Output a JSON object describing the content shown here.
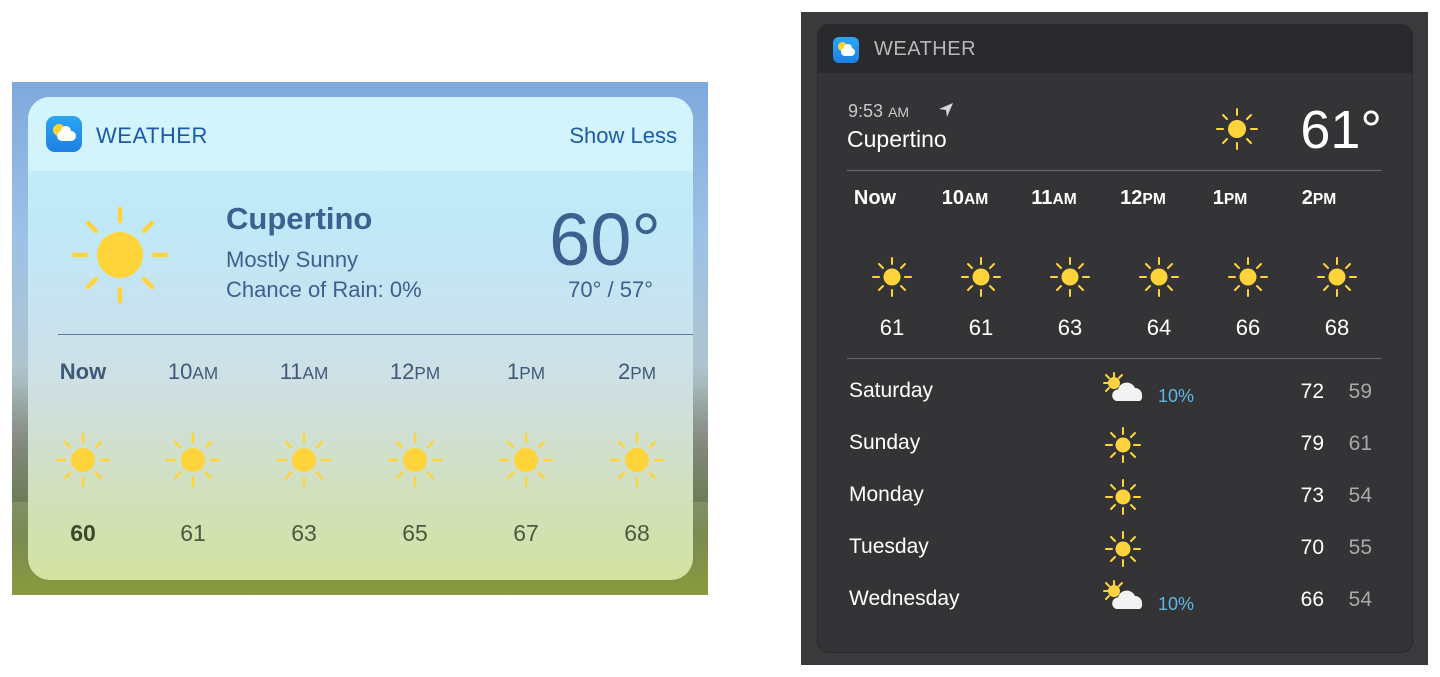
{
  "ios_widget": {
    "app_name": "WEATHER",
    "show_less_label": "Show Less",
    "city": "Cupertino",
    "condition": "Mostly Sunny",
    "chance_of_rain": "Chance of Rain: 0%",
    "temperature": "60°",
    "high_low": "70° / 57°",
    "hourly": [
      {
        "hour": "Now",
        "suffix": "",
        "icon": "sun-icon",
        "temp": "60"
      },
      {
        "hour": "10",
        "suffix": "AM",
        "icon": "sun-icon",
        "temp": "61"
      },
      {
        "hour": "11",
        "suffix": "AM",
        "icon": "sun-icon",
        "temp": "63"
      },
      {
        "hour": "12",
        "suffix": "PM",
        "icon": "sun-icon",
        "temp": "65"
      },
      {
        "hour": "1",
        "suffix": "PM",
        "icon": "sun-icon",
        "temp": "67"
      },
      {
        "hour": "2",
        "suffix": "PM",
        "icon": "sun-icon",
        "temp": "68"
      }
    ]
  },
  "mac_widget": {
    "app_name": "WEATHER",
    "time": "9:53",
    "time_suffix": "AM",
    "city": "Cupertino",
    "temperature": "61°",
    "current_icon": "sun-icon",
    "hourly": [
      {
        "hour": "Now",
        "suffix": "",
        "icon": "sun-icon",
        "temp": "61"
      },
      {
        "hour": "10",
        "suffix": "AM",
        "icon": "sun-icon",
        "temp": "61"
      },
      {
        "hour": "11",
        "suffix": "AM",
        "icon": "sun-icon",
        "temp": "63"
      },
      {
        "hour": "12",
        "suffix": "PM",
        "icon": "sun-icon",
        "temp": "64"
      },
      {
        "hour": "1",
        "suffix": "PM",
        "icon": "sun-icon",
        "temp": "66"
      },
      {
        "hour": "2",
        "suffix": "PM",
        "icon": "sun-icon",
        "temp": "68"
      }
    ],
    "daily": [
      {
        "day": "Saturday",
        "icon": "partly-cloudy-icon",
        "precip": "10%",
        "high": "72",
        "low": "59"
      },
      {
        "day": "Sunday",
        "icon": "sun-icon",
        "precip": "",
        "high": "79",
        "low": "61"
      },
      {
        "day": "Monday",
        "icon": "sun-icon",
        "precip": "",
        "high": "73",
        "low": "54"
      },
      {
        "day": "Tuesday",
        "icon": "sun-icon",
        "precip": "",
        "high": "70",
        "low": "55"
      },
      {
        "day": "Wednesday",
        "icon": "partly-cloudy-icon",
        "precip": "10%",
        "high": "66",
        "low": "54"
      }
    ]
  },
  "colors": {
    "ios_accent": "#1a5aa8",
    "sun_yellow": "#ffd43b",
    "mac_precip": "#5fb6e8"
  }
}
